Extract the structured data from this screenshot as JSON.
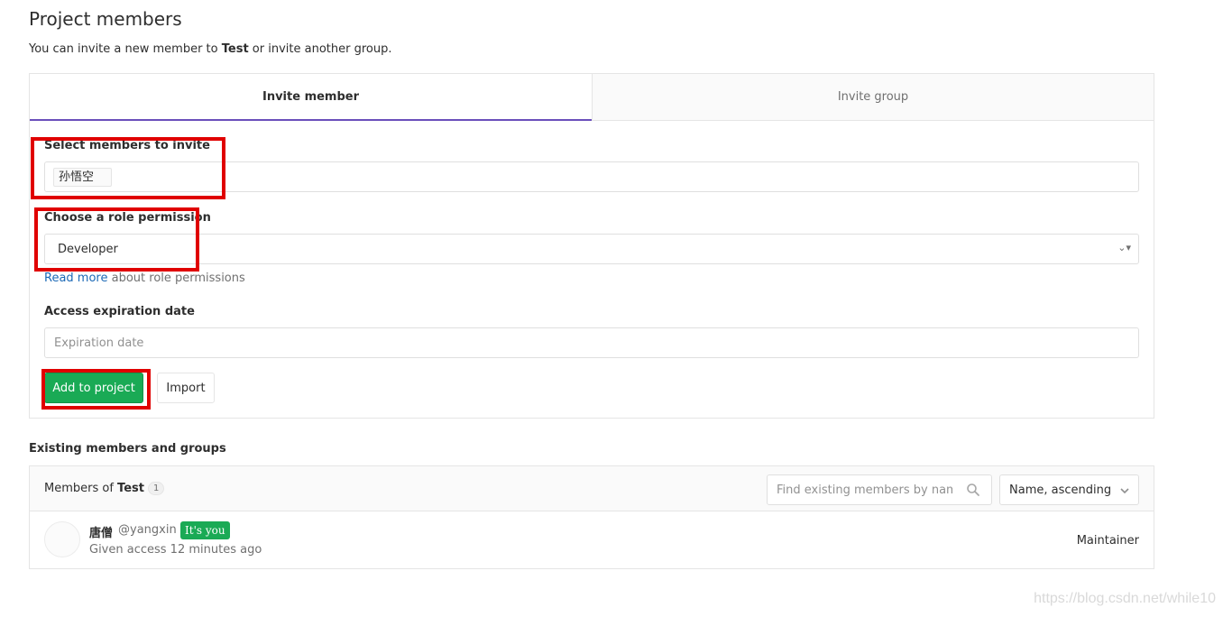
{
  "page": {
    "title": "Project members",
    "subtitle_pre": "You can invite a new member to ",
    "subtitle_project": "Test",
    "subtitle_post": " or invite another group."
  },
  "tabs": [
    {
      "label": "Invite member",
      "active": true
    },
    {
      "label": "Invite group",
      "active": false
    }
  ],
  "invite_form": {
    "members_label": "Select members to invite",
    "selected_member": "孙悟空",
    "role_label": "Choose a role permission",
    "role_value": "Developer",
    "read_more_link": "Read more",
    "read_more_suffix": " about role permissions",
    "expiration_label": "Access expiration date",
    "expiration_placeholder": "Expiration date",
    "add_button": "Add to project",
    "import_button": "Import"
  },
  "existing": {
    "heading": "Existing members and groups",
    "members_of": "Members of ",
    "project_name": "Test",
    "count": "1",
    "search_placeholder": "Find existing members by name",
    "sort_label": "Name, ascending",
    "members": [
      {
        "name": "唐僧",
        "username": "@yangxin",
        "badge": "It's you",
        "access": "Given access 12 minutes ago",
        "role": "Maintainer"
      }
    ]
  },
  "watermark": "https://blog.csdn.net/while10",
  "colors": {
    "accent_tab": "#6b4fbb",
    "success": "#1aaa55",
    "highlight": "#e00000",
    "link": "#1b69b6"
  },
  "icons": {
    "search": "search-icon",
    "chevron": "chevron-down-icon"
  }
}
